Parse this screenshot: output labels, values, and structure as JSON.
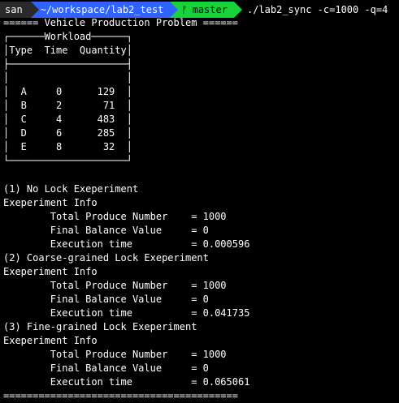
{
  "prompt": {
    "user": "san",
    "path": "~/workspace/lab2_test",
    "git_icon": "git-branch-icon",
    "branch": "master",
    "command": "./lab2_sync -c=1000 -q=4"
  },
  "colors": {
    "background": "#000000",
    "text": "#ffffff",
    "user_segment": "#2a2a2a",
    "path_segment": "#2f62ff",
    "git_segment": "#19d33b"
  },
  "output_lines": [
    "====== Vehicle Production Problem ======",
    "┌──────Workload──────┐",
    "│Type  Time  Quantity│",
    "├────────────────────┤",
    "│                    │",
    "│  A     0      129  │",
    "│  B     2       71  │",
    "│  C     4      483  │",
    "│  D     6      285  │",
    "│  E     8       32  │",
    "└────────────────────┘",
    "",
    "(1) No Lock Exeperiment",
    "Exeperiment Info",
    "        Total Produce Number    = 1000",
    "        Final Balance Value     = 0",
    "        Execution time          = 0.000596",
    "(2) Coarse-grained Lock Exeperiment",
    "Exeperiment Info",
    "        Total Produce Number    = 1000",
    "        Final Balance Value     = 0",
    "        Execution time          = 0.041735",
    "(3) Fine-grained Lock Exeperiment",
    "Exeperiment Info",
    "        Total Produce Number    = 1000",
    "        Final Balance Value     = 0",
    "        Execution time          = 0.065061",
    "========================================"
  ]
}
